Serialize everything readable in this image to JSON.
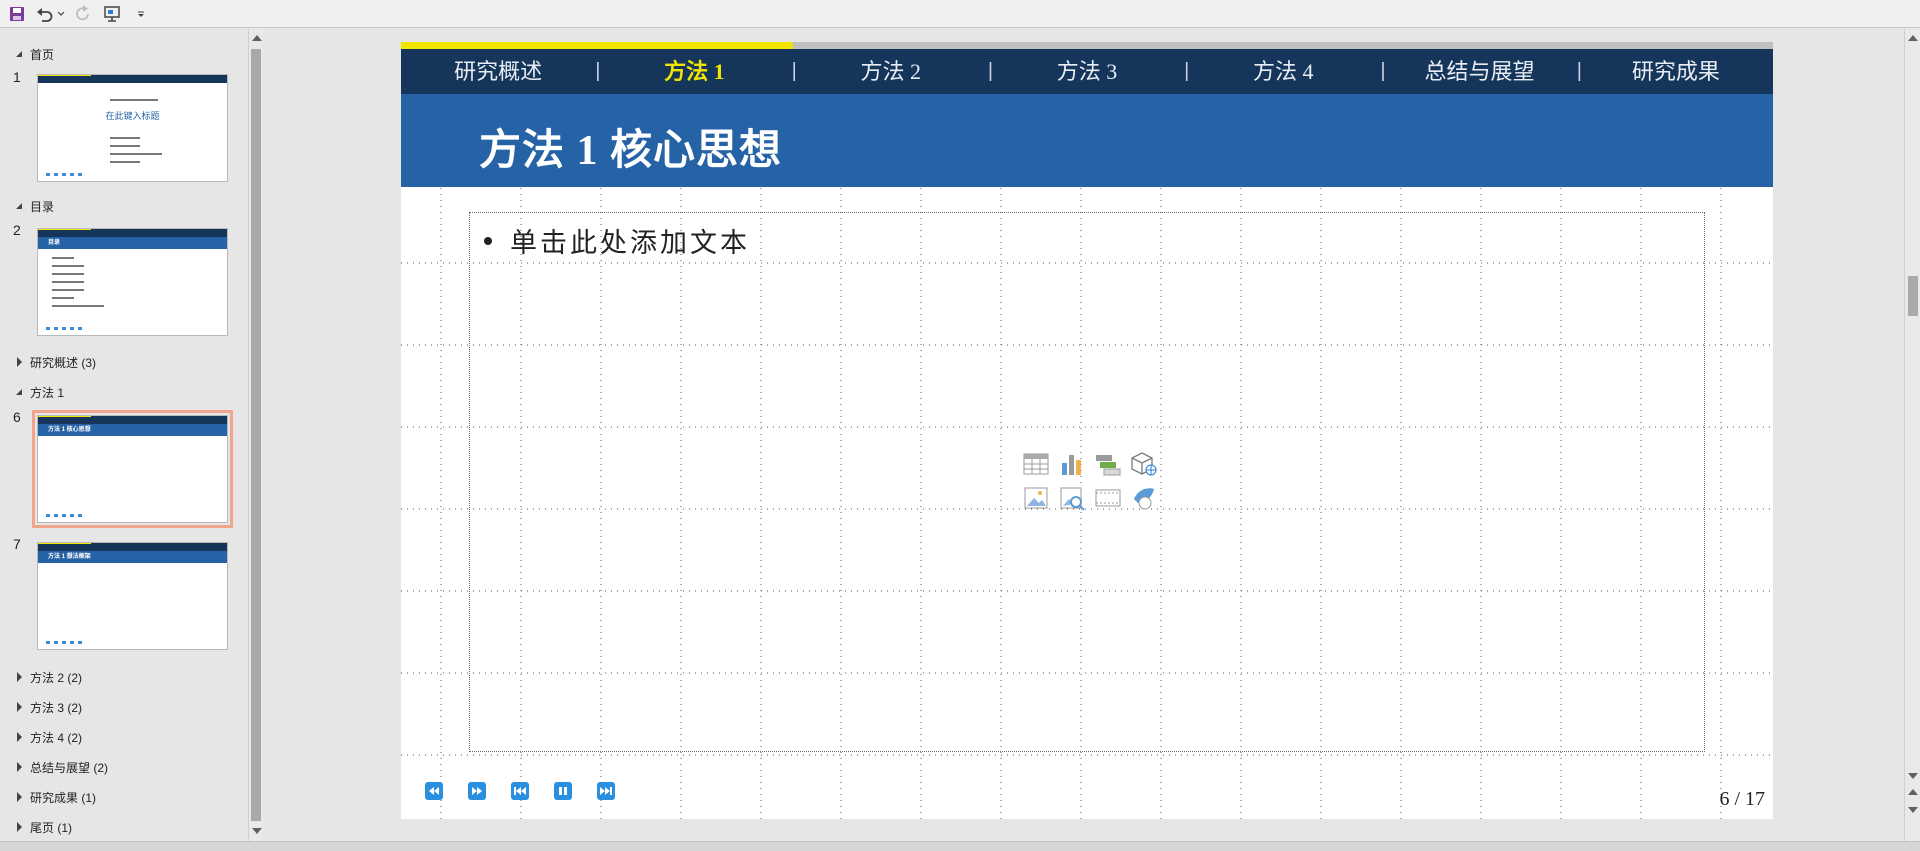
{
  "toolbar": {
    "icons": [
      "save-icon",
      "undo-icon",
      "undo-dropdown-icon",
      "redo-icon",
      "presentation-icon",
      "customize-toolbar-icon"
    ]
  },
  "sidebar": {
    "sections": [
      {
        "label": "首页",
        "expanded": true
      },
      {
        "label": "目录",
        "expanded": true
      },
      {
        "label": "研究概述 (3)",
        "expanded": false
      },
      {
        "label": "方法 1",
        "expanded": true
      },
      {
        "label": "方法 2 (2)",
        "expanded": false
      },
      {
        "label": "方法 3 (2)",
        "expanded": false
      },
      {
        "label": "方法 4 (2)",
        "expanded": false
      },
      {
        "label": "总结与展望 (2)",
        "expanded": false
      },
      {
        "label": "研究成果 (1)",
        "expanded": false
      },
      {
        "label": "尾页 (1)",
        "expanded": false
      }
    ],
    "slides": [
      {
        "number": "1",
        "thumb_title": "在此键入标题"
      },
      {
        "number": "2",
        "thumb_title": "目录"
      },
      {
        "number": "6",
        "thumb_title": "方法 1 核心思想",
        "selected": true
      },
      {
        "number": "7",
        "thumb_title": "方法 1 想法框架"
      }
    ]
  },
  "slide": {
    "progress": 0.286,
    "nav_tabs": [
      {
        "label": "研究概述",
        "active": false
      },
      {
        "label": "方法 1",
        "active": true
      },
      {
        "label": "方法 2",
        "active": false
      },
      {
        "label": "方法 3",
        "active": false
      },
      {
        "label": "方法 4",
        "active": false
      },
      {
        "label": "总结与展望",
        "active": false
      },
      {
        "label": "研究成果",
        "active": false
      }
    ],
    "nav_separator": "|",
    "title": "方法 1 核心思想",
    "bullet_placeholder": "单击此处添加文本",
    "insert_icons": [
      "table-icon",
      "chart-icon",
      "smartart-icon",
      "3d-model-icon",
      "picture-icon",
      "online-picture-icon",
      "video-icon",
      "icons-icon"
    ],
    "media_controls": [
      "rewind-icon",
      "fast-forward-icon",
      "skip-back-icon",
      "pause-icon",
      "skip-forward-icon"
    ],
    "page_number": "6 / 17"
  },
  "colors": {
    "nav_bg": "#15355a",
    "title_bg": "#2563a6",
    "active_tab": "#f2e600",
    "media_blue": "#2b8fe0"
  }
}
